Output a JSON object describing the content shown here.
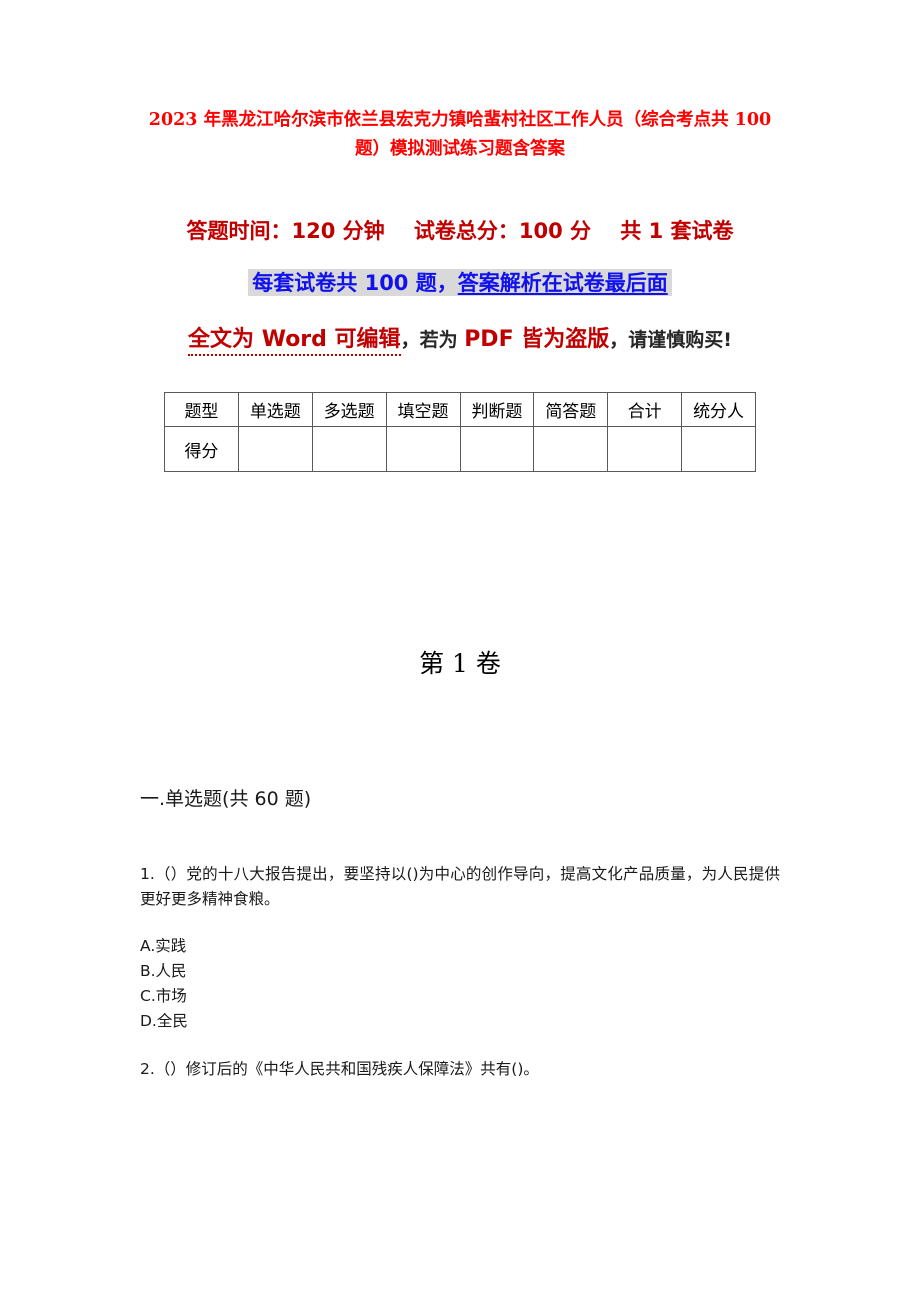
{
  "document": {
    "title": "2023 年黑龙江哈尔滨市依兰县宏克力镇哈蜚村社区工作人员（综合考点共 100 题）模拟测试练习题含答案",
    "info_line": "答题时间：120 分钟    试卷总分：100 分    共 1 套试卷",
    "highlight_line": {
      "plain": "每套试卷共 100 题，",
      "underlined": "答案解析在试卷最后面"
    },
    "warning": {
      "part_red_underlined": "全文为 Word 可编辑",
      "part_dark_1": "，若为 ",
      "part_red_2": "PDF 皆为盗版",
      "part_dark_2": "，请谨慎购买!"
    },
    "colors": {
      "title_red": "#FF0000",
      "info_red": "#C00000",
      "highlight_blue": "#1111EE",
      "highlight_background": "#D9D9D9",
      "warning_red": "#C00000",
      "body_dark": "#1A1A1A",
      "table_border": "#595959"
    },
    "volume_label": "第 1 卷",
    "section_heading": "一.单选题(共 60 题)"
  },
  "score_table": {
    "headers": [
      "题型",
      "单选题",
      "多选题",
      "填空题",
      "判断题",
      "简答题",
      "合计",
      "统分人"
    ],
    "rows": [
      {
        "label": "得分",
        "cells": [
          "",
          "",
          "",
          "",
          "",
          "",
          ""
        ]
      }
    ]
  },
  "questions": [
    {
      "number": "1.",
      "text": "1.（）党的十八大报告提出，要坚持以()为中心的创作导向，提高文化产品质量，为人民提供更好更多精神食粮。",
      "options": [
        "A.实践",
        "B.人民",
        "C.市场",
        "D.全民"
      ]
    },
    {
      "number": "2.",
      "text": "2.（）修订后的《中华人民共和国残疾人保障法》共有()。",
      "options": []
    }
  ]
}
